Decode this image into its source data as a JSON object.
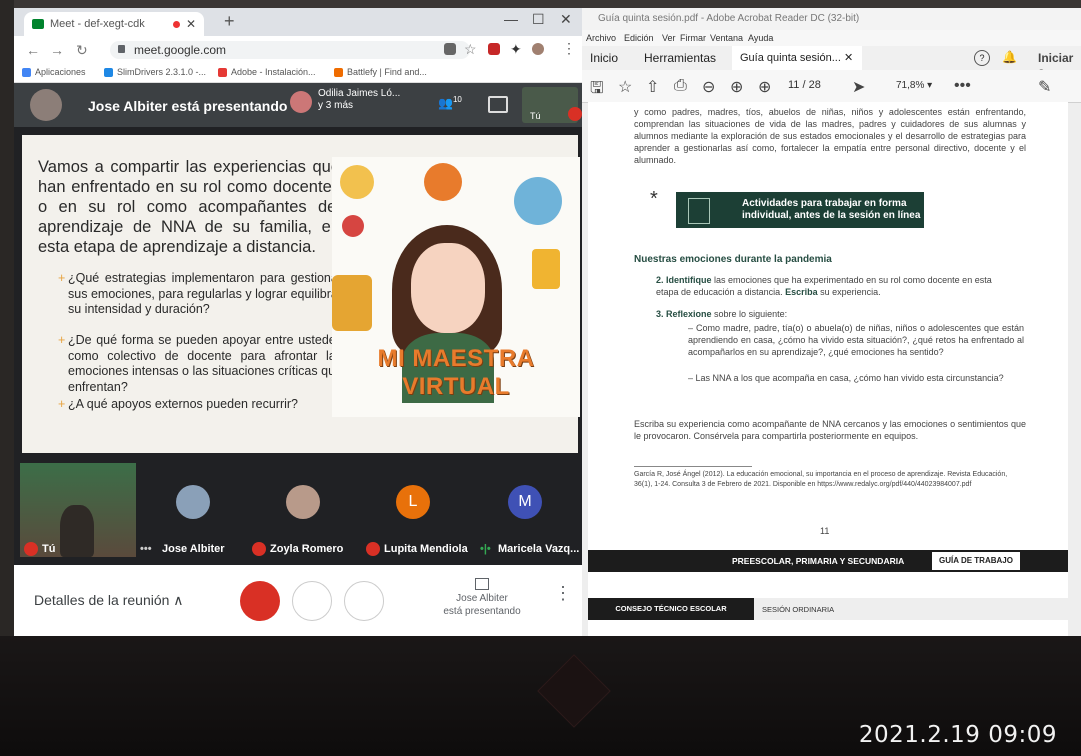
{
  "timestamp": "2021.2.19 09:09",
  "chrome": {
    "tab_title": "Meet - def-xegt-cdk",
    "url": "meet.google.com",
    "bookmarks": [
      "Aplicaciones",
      "SlimDrivers 2.3.1.0 -...",
      "Adobe - Instalación...",
      "Battlefy | Find and..."
    ]
  },
  "meet": {
    "presenter_banner": "Jose Albiter está presentando",
    "participants_line1": "Odilia Jaimes Ló...",
    "participants_line2": "y 3 más",
    "people_count": "10",
    "self_label": "Tú",
    "slide": {
      "title": "Vamos a compartir las experiencias que han enfrentado en su rol como docentes o en su rol como acompañantes del aprendizaje de NNA de su familia, en esta etapa de aprendizaje a distancia.",
      "bullets": [
        "¿Qué estrategias implementaron para gestionar sus emociones, para regularlas y lograr equilibrar su intensidad y duración?",
        "¿De qué forma se pueden apoyar entre ustedes como colectivo de docente para afrontar las emociones intensas o las situaciones críticas que enfrentan?",
        "¿A qué apoyos externos pueden recurrir?"
      ],
      "banner": "MI MAESTRA VIRTUAL"
    },
    "participants": [
      {
        "name": "Tú",
        "color": "#5a4a3c"
      },
      {
        "name": "Jose Albiter",
        "color": "#8aa0b8"
      },
      {
        "name": "Zoyla Romero",
        "color": "#b89a8a"
      },
      {
        "name": "Lupita Mendiola",
        "initial": "L",
        "color": "#e8710a"
      },
      {
        "name": "Maricela Vazq...",
        "initial": "M",
        "color": "#3f51b5"
      }
    ],
    "details_label": "Detalles de la reunión",
    "present_line1": "Jose Albiter",
    "present_line2": "está presentando"
  },
  "acrobat": {
    "window_title": "Guía quinta sesión.pdf - Adobe Acrobat Reader DC (32-bit)",
    "menu": [
      "Archivo",
      "Edición",
      "Ver",
      "Firmar",
      "Ventana",
      "Ayuda"
    ],
    "tabs": [
      "Inicio",
      "Herramientas",
      "Guía quinta sesión..."
    ],
    "sign_in": "Iniciar s",
    "page_current": "11",
    "page_total": "/ 28",
    "zoom": "71,8%",
    "document": {
      "intro": "y como padres, madres, tíos, abuelos de niñas, niños y adolescentes están enfrentando, comprendan las situaciones de vida de las madres, padres y cuidadores de sus alumnas y alumnos mediante la exploración de sus estados emocionales y el desarrollo de estrategias para aprender a gestionarlas así como, fortalecer la empatía entre personal directivo, docente y el alumnado.",
      "box_text": "Actividades para trabajar en forma individual, antes de la sesión en línea",
      "section_title": "Nuestras emociones durante la pandemia",
      "item2_num": "2.",
      "item2_verb": "Identifique",
      "item2_text": " las emociones que ha experimentado en su rol como docente en esta etapa de educación a distancia. ",
      "item2_verb2": "Escriba",
      "item2_text2": " su experiencia.",
      "item3_num": "3.",
      "item3_verb": "Reflexione",
      "item3_text": " sobre lo siguiente:",
      "dash1": "Como madre, padre, tía(o) o abuela(o) de niñas, niños o adolescentes que están aprendiendo en casa, ¿cómo ha vivido esta situación?, ¿qué retos ha enfrentado al acompañarlos en su aprendizaje?, ¿qué emociones ha sentido?",
      "dash2": "Las NNA a los que acompaña en casa, ¿cómo han vivido esta circunstancia?",
      "closing": "Escriba su experiencia como acompañante de NNA cercanos y las emociones o sentimientos que le provocaron. Consérvela para compartirla posteriormente en equipos.",
      "footnote": "García R, José Ángel (2012). La educación emocional, su importancia en el proceso de aprendizaje. Revista Educación, 36(1), 1-24. Consulta 3 de Febrero de 2021. Disponible en https://www.redalyc.org/pdf/440/44023984007.pdf",
      "page_number": "11",
      "footer1": "PREESCOLAR, PRIMARIA Y SECUNDARIA",
      "footer1_tag": "GUÍA DE TRABAJO",
      "footer2": "CONSEJO TÉCNICO ESCOLAR",
      "footer2_tag": "SESIÓN ORDINARIA"
    }
  }
}
